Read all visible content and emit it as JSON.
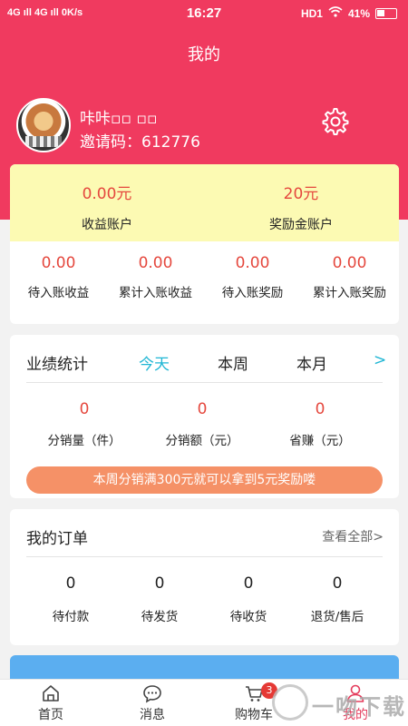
{
  "status": {
    "network": "4G ıll 4G ıll 0K/s",
    "time": "16:27",
    "right": "HD1",
    "battery": "41%"
  },
  "header": {
    "title": "我的"
  },
  "user": {
    "name": "咔咔▫▫ ▫▫",
    "invite": "邀请码：612776"
  },
  "accounts": [
    {
      "value": "0.00元",
      "label": "收益账户"
    },
    {
      "value": "20元",
      "label": "奖励金账户"
    }
  ],
  "sub_accounts": [
    {
      "value": "0.00",
      "label": "待入账收益"
    },
    {
      "value": "0.00",
      "label": "累计入账收益"
    },
    {
      "value": "0.00",
      "label": "待入账奖励"
    },
    {
      "value": "0.00",
      "label": "累计入账奖励"
    }
  ],
  "performance": {
    "title": "业绩统计",
    "tabs": [
      "今天",
      "本周",
      "本月"
    ],
    "arrow": ">",
    "stats": [
      {
        "value": "0",
        "label": "分销量（件）"
      },
      {
        "value": "0",
        "label": "分销额（元）"
      },
      {
        "value": "0",
        "label": "省赚（元）"
      }
    ],
    "banner": "本周分销满300元就可以拿到5元奖励喽"
  },
  "orders": {
    "title": "我的订单",
    "view_all": "查看全部>",
    "stats": [
      {
        "value": "0",
        "label": "待付款"
      },
      {
        "value": "0",
        "label": "待发货"
      },
      {
        "value": "0",
        "label": "待收货"
      },
      {
        "value": "0",
        "label": "退货/售后"
      }
    ]
  },
  "tabbar": {
    "items": [
      {
        "label": "首页",
        "icon": "home-icon"
      },
      {
        "label": "消息",
        "icon": "message-icon"
      },
      {
        "label": "购物车",
        "icon": "cart-icon",
        "badge": "3"
      },
      {
        "label": "我的",
        "icon": "user-icon"
      }
    ]
  },
  "watermark": {
    "text": "一吻下载"
  },
  "colors": {
    "primary": "#f03a5f",
    "accent": "#1fb6d4",
    "value_red": "#e5483e",
    "banner": "#f59167",
    "account_bg": "#fcfab3"
  }
}
